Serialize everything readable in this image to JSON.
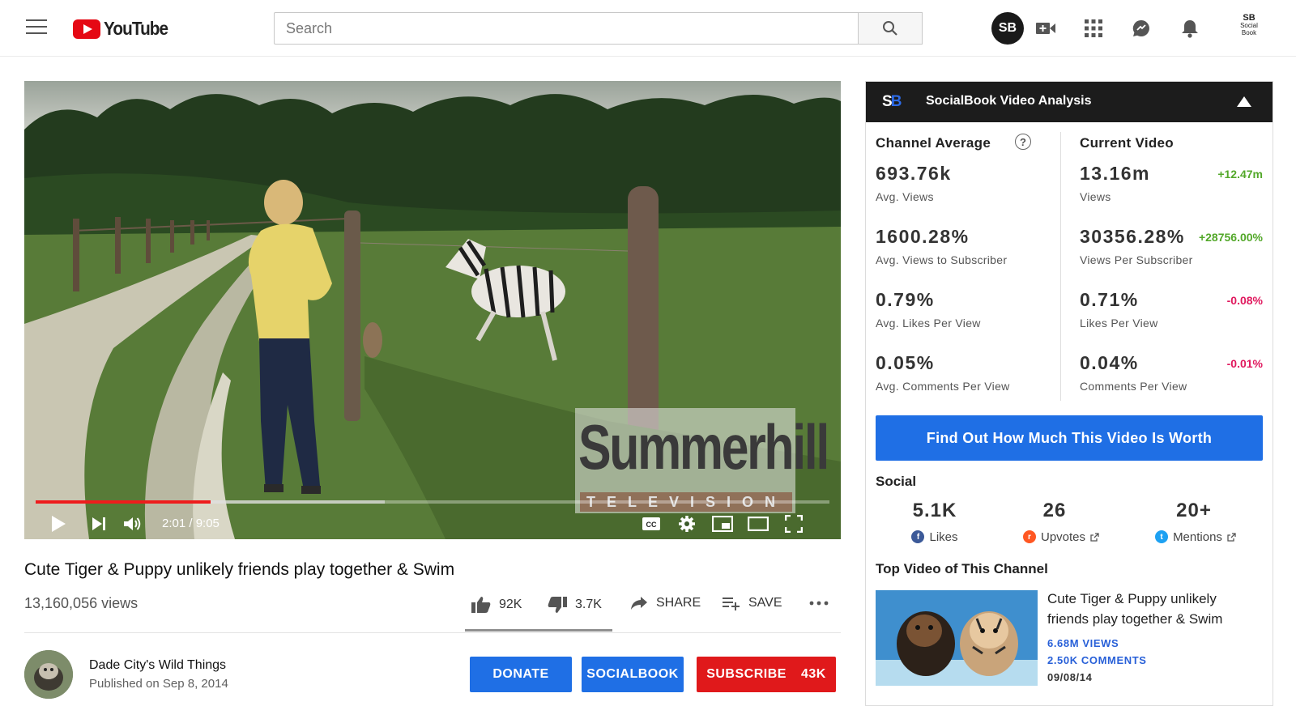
{
  "header": {
    "logo_text": "YouTube",
    "search_placeholder": "Search",
    "avatar_text": "SB",
    "socialbook_badge_line1": "SB",
    "socialbook_badge_line2": "Social",
    "socialbook_badge_line3": "Book"
  },
  "player": {
    "time": "2:01 / 9:05",
    "progress_fraction": 0.22,
    "buffer_fraction": 0.44,
    "watermark_main": "Summerhill",
    "watermark_sub": "TELEVISION"
  },
  "video": {
    "title": "Cute Tiger & Puppy unlikely friends play together & Swim",
    "views": "13,160,056 views",
    "likes": "92K",
    "dislikes": "3.7K",
    "share_label": "SHARE",
    "save_label": "SAVE"
  },
  "owner": {
    "name": "Dade City's Wild Things",
    "published": "Published on Sep 8, 2014",
    "donate_label": "DONATE",
    "socialbook_label": "SOCIALBOOK",
    "subscribe_label": "SUBSCRIBE",
    "subscriber_count": "43K"
  },
  "panel": {
    "logo_s": "S",
    "logo_b": "B",
    "title": "SocialBook Video Analysis",
    "channel_average_heading": "Channel Average",
    "current_video_heading": "Current Video",
    "help_glyph": "?",
    "channel_stats": [
      {
        "value": "693.76k",
        "label": "Avg. Views"
      },
      {
        "value": "1600.28%",
        "label": "Avg. Views to Subscriber"
      },
      {
        "value": "0.79%",
        "label": "Avg. Likes Per View"
      },
      {
        "value": "0.05%",
        "label": "Avg. Comments Per View"
      }
    ],
    "current_stats": [
      {
        "value": "13.16m",
        "label": "Views",
        "delta": "+12.47m",
        "delta_dir": "up"
      },
      {
        "value": "30356.28%",
        "label": "Views Per Subscriber",
        "delta": "+28756.00%",
        "delta_dir": "up"
      },
      {
        "value": "0.71%",
        "label": "Likes Per View",
        "delta": "-0.08%",
        "delta_dir": "down"
      },
      {
        "value": "0.04%",
        "label": "Comments Per View",
        "delta": "-0.01%",
        "delta_dir": "down"
      }
    ],
    "worth_button": "Find Out How Much This Video Is Worth",
    "social_heading": "Social",
    "social": [
      {
        "value": "5.1K",
        "label": "Likes",
        "color": "#3b5998"
      },
      {
        "value": "26",
        "label": "Upvotes",
        "color": "#ff5722"
      },
      {
        "value": "20+",
        "label": "Mentions",
        "color": "#1da1f2"
      }
    ],
    "top_video_heading": "Top Video of This Channel",
    "top_video": {
      "title": "Cute Tiger & Puppy unlikely friends play together & Swim",
      "views": "6.68M VIEWS",
      "comments": "2.50K COMMENTS",
      "date": "09/08/14"
    }
  },
  "colors": {
    "youtube_red": "#e50914",
    "button_blue": "#1f6fe5",
    "subscribe_red": "#e0191b",
    "delta_up": "#53a82a",
    "delta_down": "#e0195e"
  }
}
